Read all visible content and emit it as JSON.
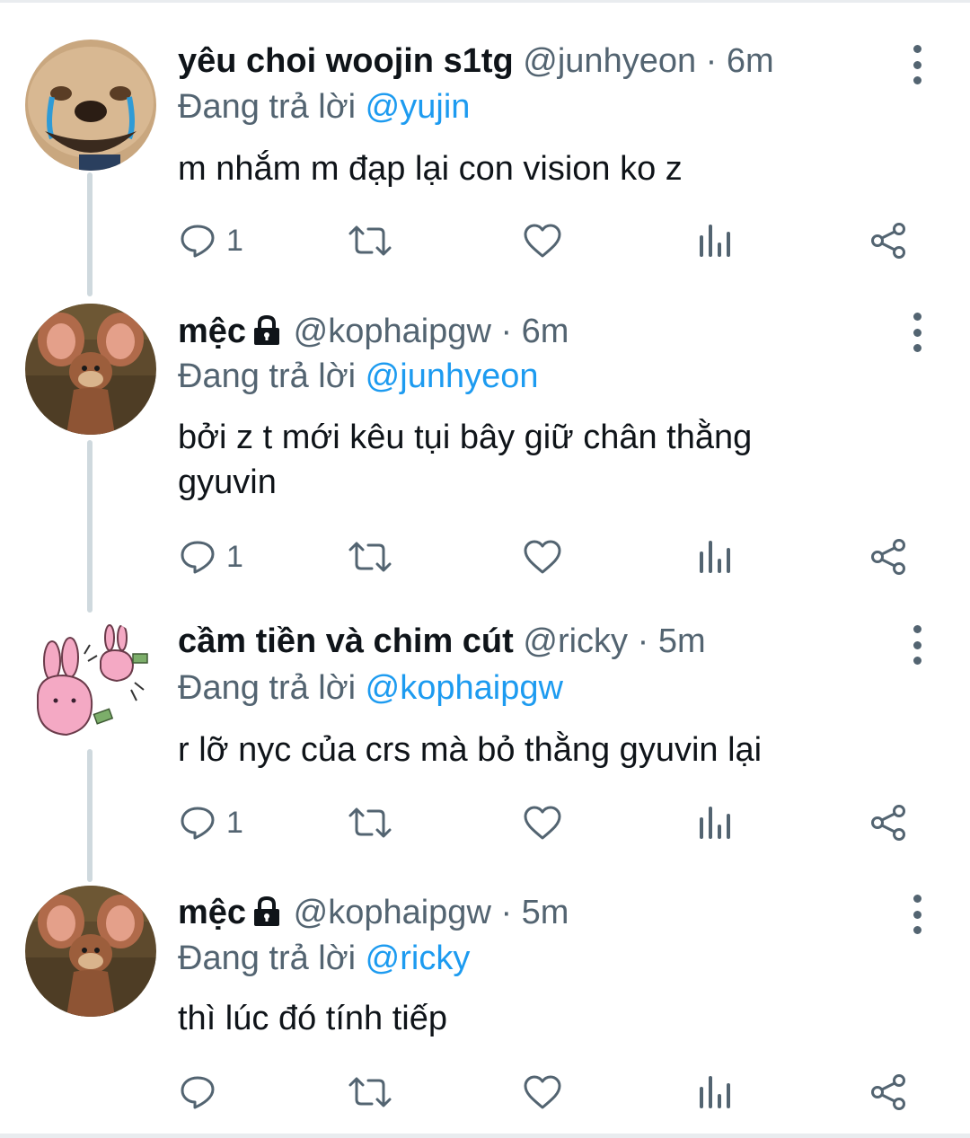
{
  "colors": {
    "link": "#1d9bf0",
    "secondary": "#536471",
    "text": "#0f1419",
    "thread_line": "#cfd9de"
  },
  "tweets": [
    {
      "display_name": "yêu choi woojin s1tg",
      "handle": "@junhyeon",
      "time": "6m",
      "locked": false,
      "replying_label": "Đang trả lời",
      "replying_to": "@yujin",
      "text": "m nhắm m đạp lại con vision ko z",
      "reply_count": "1",
      "avatar": "crying-dog-avatar"
    },
    {
      "display_name": "mệc",
      "handle": "@kophaipgw",
      "time": "6m",
      "locked": true,
      "replying_label": "Đang trả lời",
      "replying_to": "@junhyeon",
      "text": "bởi z t mới kêu tụi bây giữ chân thằng gyuvin",
      "reply_count": "1",
      "avatar": "cartoon-mouse-avatar"
    },
    {
      "display_name": "cầm tiền và chim cút",
      "handle": "@ricky",
      "time": "5m",
      "locked": false,
      "replying_label": "Đang trả lời",
      "replying_to": "@kophaipgw",
      "text": "r lỡ nyc của crs mà bỏ thằng gyuvin lại",
      "reply_count": "1",
      "avatar": "pink-rabbit-avatar"
    },
    {
      "display_name": "mệc",
      "handle": "@kophaipgw",
      "time": "5m",
      "locked": true,
      "replying_label": "Đang trả lời",
      "replying_to": "@ricky",
      "text": "thì lúc đó tính tiếp",
      "reply_count": "",
      "avatar": "cartoon-mouse-avatar"
    }
  ],
  "separator": "·"
}
